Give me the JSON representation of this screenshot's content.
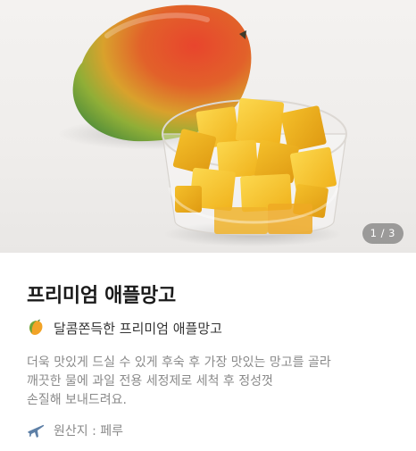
{
  "gallery": {
    "current": "1",
    "separator": "/",
    "total": "3",
    "image_alt": "mango-photo"
  },
  "product": {
    "title": "프리미엄 애플망고",
    "tagline_icon": "mango-icon",
    "tagline": "달콤쫀득한 프리미엄 애플망고",
    "description_lines": [
      "더욱 맛있게 드실 수 있게 후숙 후 가장 맛있는 망고를 골라",
      "깨끗한 물에 과일 전용 세정제로 세척 후 정성껏",
      "손질해 보내드려요."
    ],
    "origin_icon": "airplane-icon",
    "origin": "원산지 : 페루"
  },
  "colors": {
    "title": "#1a1a1a",
    "muted_text": "#8a8a8a",
    "indicator_bg": "#5a5a5a",
    "mango_yellow": "#f6c42b"
  }
}
